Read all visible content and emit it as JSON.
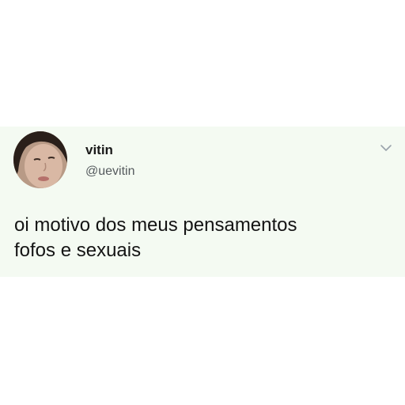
{
  "tweet": {
    "display_name": "vitin",
    "handle": "@uevitin",
    "text_lines": [
      "oi motivo dos meus pensamentos",
      "fofos e sexuais"
    ],
    "menu_icon": "chevron-down-icon",
    "avatar_icon": "avatar"
  },
  "colors": {
    "card_background": "#f4faf2",
    "text_primary": "#141414",
    "text_secondary": "#555a5e"
  }
}
